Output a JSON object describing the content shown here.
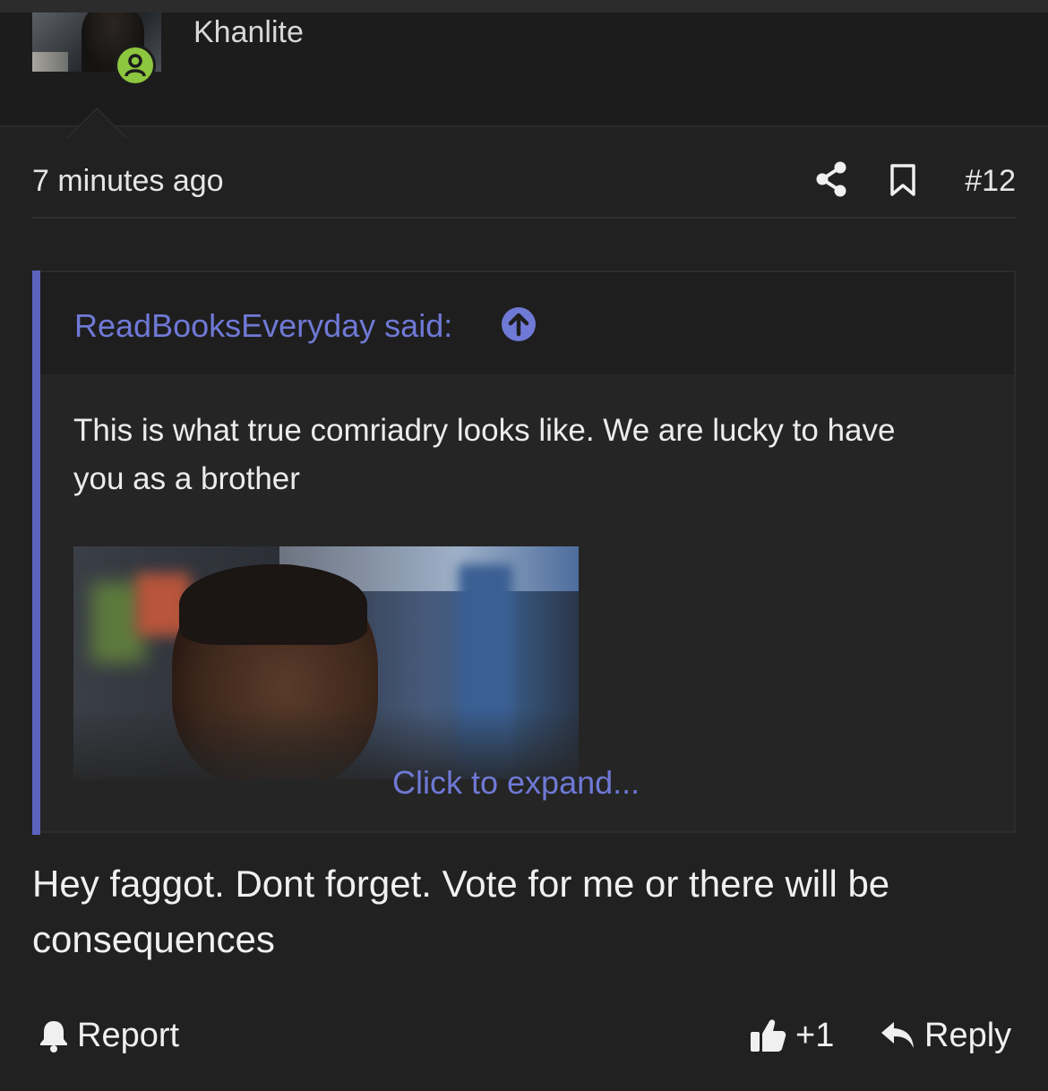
{
  "user": {
    "name": "Khanlite",
    "status_icon": "user-online-icon",
    "status_color": "#8dc63f"
  },
  "post": {
    "timestamp": "7 minutes ago",
    "number": "#12",
    "actions": {
      "share_icon": "share-icon",
      "bookmark_icon": "bookmark-icon"
    },
    "body": "Hey faggot. Dont forget. Vote for me or there will be consequences"
  },
  "quote": {
    "author_label": "ReadBooksEveryday said:",
    "jump_icon": "arrow-up-circle-icon",
    "text": "This is what true comriadry looks like. We are lucky to have you as a brother",
    "expand_label": "Click to expand...",
    "accent_color": "#5b62bd"
  },
  "footer": {
    "report_label": "Report",
    "like_count": "+1",
    "reply_label": "Reply"
  }
}
